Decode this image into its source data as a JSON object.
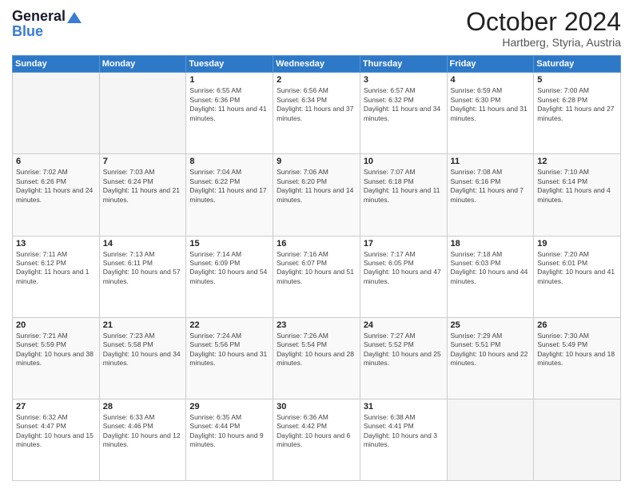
{
  "header": {
    "logo_line1": "General",
    "logo_line2": "Blue",
    "month": "October 2024",
    "location": "Hartberg, Styria, Austria"
  },
  "weekdays": [
    "Sunday",
    "Monday",
    "Tuesday",
    "Wednesday",
    "Thursday",
    "Friday",
    "Saturday"
  ],
  "weeks": [
    [
      {
        "day": "",
        "empty": true
      },
      {
        "day": "",
        "empty": true
      },
      {
        "day": "1",
        "sunrise": "6:55 AM",
        "sunset": "6:36 PM",
        "daylight": "11 hours and 41 minutes."
      },
      {
        "day": "2",
        "sunrise": "6:56 AM",
        "sunset": "6:34 PM",
        "daylight": "11 hours and 37 minutes."
      },
      {
        "day": "3",
        "sunrise": "6:57 AM",
        "sunset": "6:32 PM",
        "daylight": "11 hours and 34 minutes."
      },
      {
        "day": "4",
        "sunrise": "6:59 AM",
        "sunset": "6:30 PM",
        "daylight": "11 hours and 31 minutes."
      },
      {
        "day": "5",
        "sunrise": "7:00 AM",
        "sunset": "6:28 PM",
        "daylight": "11 hours and 27 minutes."
      }
    ],
    [
      {
        "day": "6",
        "sunrise": "7:02 AM",
        "sunset": "6:26 PM",
        "daylight": "11 hours and 24 minutes."
      },
      {
        "day": "7",
        "sunrise": "7:03 AM",
        "sunset": "6:24 PM",
        "daylight": "11 hours and 21 minutes."
      },
      {
        "day": "8",
        "sunrise": "7:04 AM",
        "sunset": "6:22 PM",
        "daylight": "11 hours and 17 minutes."
      },
      {
        "day": "9",
        "sunrise": "7:06 AM",
        "sunset": "6:20 PM",
        "daylight": "11 hours and 14 minutes."
      },
      {
        "day": "10",
        "sunrise": "7:07 AM",
        "sunset": "6:18 PM",
        "daylight": "11 hours and 11 minutes."
      },
      {
        "day": "11",
        "sunrise": "7:08 AM",
        "sunset": "6:16 PM",
        "daylight": "11 hours and 7 minutes."
      },
      {
        "day": "12",
        "sunrise": "7:10 AM",
        "sunset": "6:14 PM",
        "daylight": "11 hours and 4 minutes."
      }
    ],
    [
      {
        "day": "13",
        "sunrise": "7:11 AM",
        "sunset": "6:12 PM",
        "daylight": "11 hours and 1 minute."
      },
      {
        "day": "14",
        "sunrise": "7:13 AM",
        "sunset": "6:11 PM",
        "daylight": "10 hours and 57 minutes."
      },
      {
        "day": "15",
        "sunrise": "7:14 AM",
        "sunset": "6:09 PM",
        "daylight": "10 hours and 54 minutes."
      },
      {
        "day": "16",
        "sunrise": "7:16 AM",
        "sunset": "6:07 PM",
        "daylight": "10 hours and 51 minutes."
      },
      {
        "day": "17",
        "sunrise": "7:17 AM",
        "sunset": "6:05 PM",
        "daylight": "10 hours and 47 minutes."
      },
      {
        "day": "18",
        "sunrise": "7:18 AM",
        "sunset": "6:03 PM",
        "daylight": "10 hours and 44 minutes."
      },
      {
        "day": "19",
        "sunrise": "7:20 AM",
        "sunset": "6:01 PM",
        "daylight": "10 hours and 41 minutes."
      }
    ],
    [
      {
        "day": "20",
        "sunrise": "7:21 AM",
        "sunset": "5:59 PM",
        "daylight": "10 hours and 38 minutes."
      },
      {
        "day": "21",
        "sunrise": "7:23 AM",
        "sunset": "5:58 PM",
        "daylight": "10 hours and 34 minutes."
      },
      {
        "day": "22",
        "sunrise": "7:24 AM",
        "sunset": "5:56 PM",
        "daylight": "10 hours and 31 minutes."
      },
      {
        "day": "23",
        "sunrise": "7:26 AM",
        "sunset": "5:54 PM",
        "daylight": "10 hours and 28 minutes."
      },
      {
        "day": "24",
        "sunrise": "7:27 AM",
        "sunset": "5:52 PM",
        "daylight": "10 hours and 25 minutes."
      },
      {
        "day": "25",
        "sunrise": "7:29 AM",
        "sunset": "5:51 PM",
        "daylight": "10 hours and 22 minutes."
      },
      {
        "day": "26",
        "sunrise": "7:30 AM",
        "sunset": "5:49 PM",
        "daylight": "10 hours and 18 minutes."
      }
    ],
    [
      {
        "day": "27",
        "sunrise": "6:32 AM",
        "sunset": "4:47 PM",
        "daylight": "10 hours and 15 minutes."
      },
      {
        "day": "28",
        "sunrise": "6:33 AM",
        "sunset": "4:46 PM",
        "daylight": "10 hours and 12 minutes."
      },
      {
        "day": "29",
        "sunrise": "6:35 AM",
        "sunset": "4:44 PM",
        "daylight": "10 hours and 9 minutes."
      },
      {
        "day": "30",
        "sunrise": "6:36 AM",
        "sunset": "4:42 PM",
        "daylight": "10 hours and 6 minutes."
      },
      {
        "day": "31",
        "sunrise": "6:38 AM",
        "sunset": "4:41 PM",
        "daylight": "10 hours and 3 minutes."
      },
      {
        "day": "",
        "empty": true
      },
      {
        "day": "",
        "empty": true
      }
    ]
  ]
}
